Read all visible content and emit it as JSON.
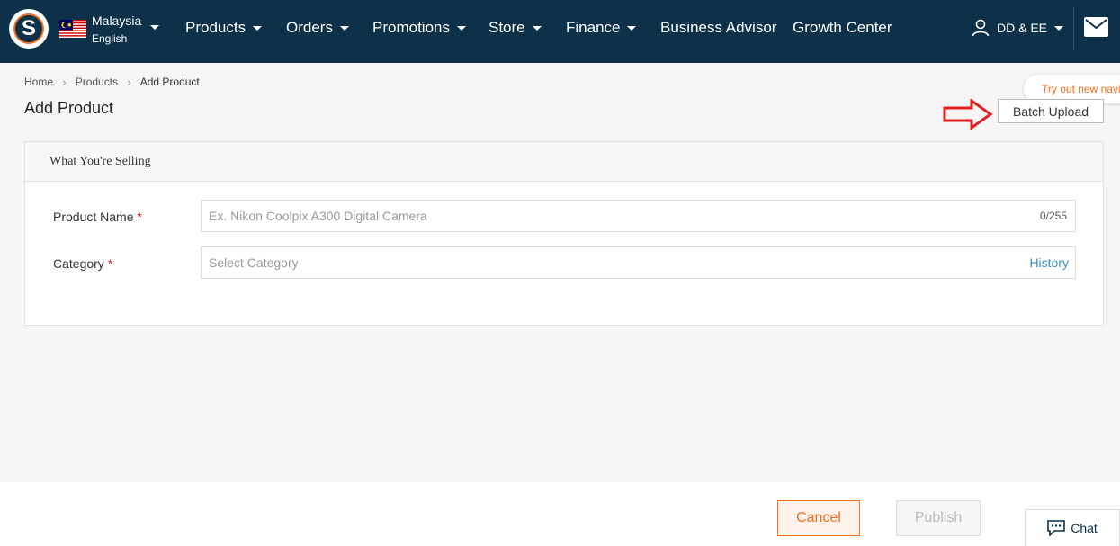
{
  "nav": {
    "locale_country": "Malaysia",
    "locale_language": "English",
    "items": [
      {
        "label": "Products",
        "has_dropdown": true
      },
      {
        "label": "Orders",
        "has_dropdown": true
      },
      {
        "label": "Promotions",
        "has_dropdown": true
      },
      {
        "label": "Store",
        "has_dropdown": true
      },
      {
        "label": "Finance",
        "has_dropdown": true
      },
      {
        "label": "Business Advisor",
        "has_dropdown": false
      },
      {
        "label": "Growth Center",
        "has_dropdown": false
      }
    ],
    "user_name": "DD & EE",
    "icons": {
      "logo": "brand-logo-icon",
      "user": "user-icon",
      "mail": "mail-icon",
      "caret": "caret-down-icon"
    }
  },
  "breadcrumb": [
    {
      "label": "Home"
    },
    {
      "label": "Products"
    },
    {
      "label": "Add Product"
    }
  ],
  "page_title": "Add Product",
  "tooltip_text": "Try out new navi",
  "batch_upload_label": "Batch Upload",
  "card": {
    "title": "What You're Selling",
    "product_name": {
      "label": "Product Name",
      "required_mark": "*",
      "placeholder": "Ex. Nikon Coolpix A300 Digital Camera",
      "value": "",
      "counter": "0/255"
    },
    "category": {
      "label": "Category",
      "required_mark": "*",
      "placeholder": "Select Category",
      "history_label": "History"
    }
  },
  "footer": {
    "cancel_label": "Cancel",
    "publish_label": "Publish",
    "chat_label": "Chat"
  },
  "colors": {
    "nav_bg": "#0c3148",
    "accent_orange": "#f37021",
    "link_blue": "#3c8dce",
    "required_red": "#e02020",
    "arrow_red": "#e02020"
  }
}
